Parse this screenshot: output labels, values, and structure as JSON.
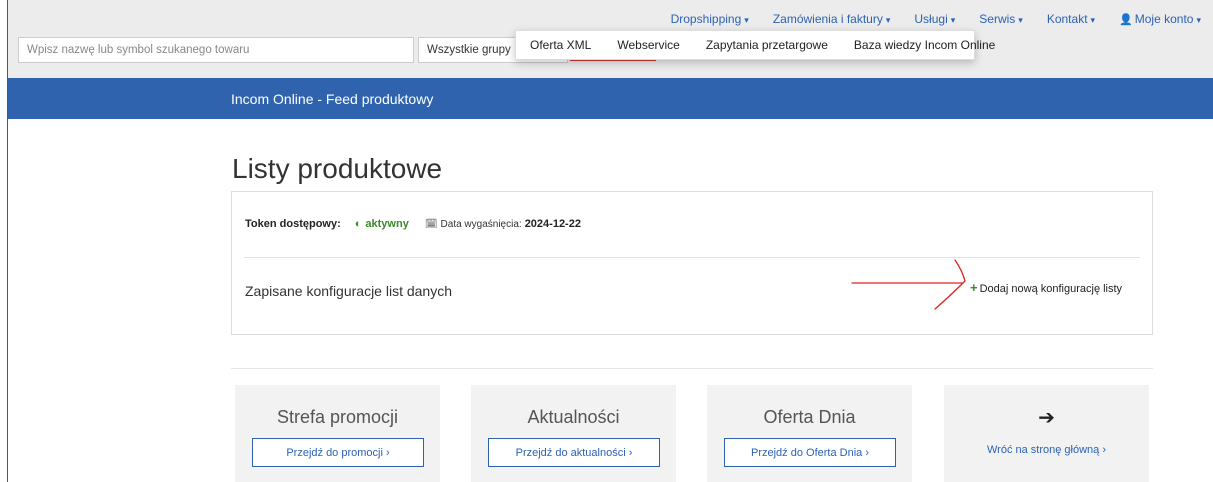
{
  "nav": {
    "menu": [
      {
        "label": "Dropshipping",
        "has_caret": true
      },
      {
        "label": "Zamówienia i faktury",
        "has_caret": true
      },
      {
        "label": "Usługi",
        "has_caret": true
      },
      {
        "label": "Serwis",
        "has_caret": true
      },
      {
        "label": "Kontakt",
        "has_caret": true
      },
      {
        "label": "Moje konto",
        "has_caret": true
      }
    ],
    "caret": "▾",
    "user_icon": "user-icon",
    "search_placeholder": "Wpisz nazwę lub symbol szukanego towaru",
    "group_select_value": "Wszystkie grupy",
    "submenu": [
      "Oferta XML",
      "Webservice",
      "Zapytania przetargowe",
      "Baza wiedzy Incom Online"
    ]
  },
  "banner": {
    "title": "Incom Online - Feed produktowy"
  },
  "page": {
    "title": "Listy produktowe"
  },
  "token": {
    "label": "Token dostępowy:",
    "status": "aktywny",
    "expiry_label": "Data wygaśnięcia:",
    "expiry_date": "2024-12-22"
  },
  "configs": {
    "label": "Zapisane konfiguracje list danych",
    "add_label": "Dodaj nową konfigurację listy"
  },
  "tiles": [
    {
      "title": "Strefa promocji",
      "button": "Przejdź do promocji ›"
    },
    {
      "title": "Aktualności",
      "button": "Przejdź do aktualności ›"
    },
    {
      "title": "Oferta Dnia",
      "button": "Przejdź do Oferta Dnia ›"
    },
    {
      "title": "➔",
      "button": "Wróć na stronę główną ›"
    }
  ],
  "colors": {
    "brand_blue": "#2f63ad",
    "active_green": "#3a8a2a",
    "annotation_red": "#e02020"
  }
}
